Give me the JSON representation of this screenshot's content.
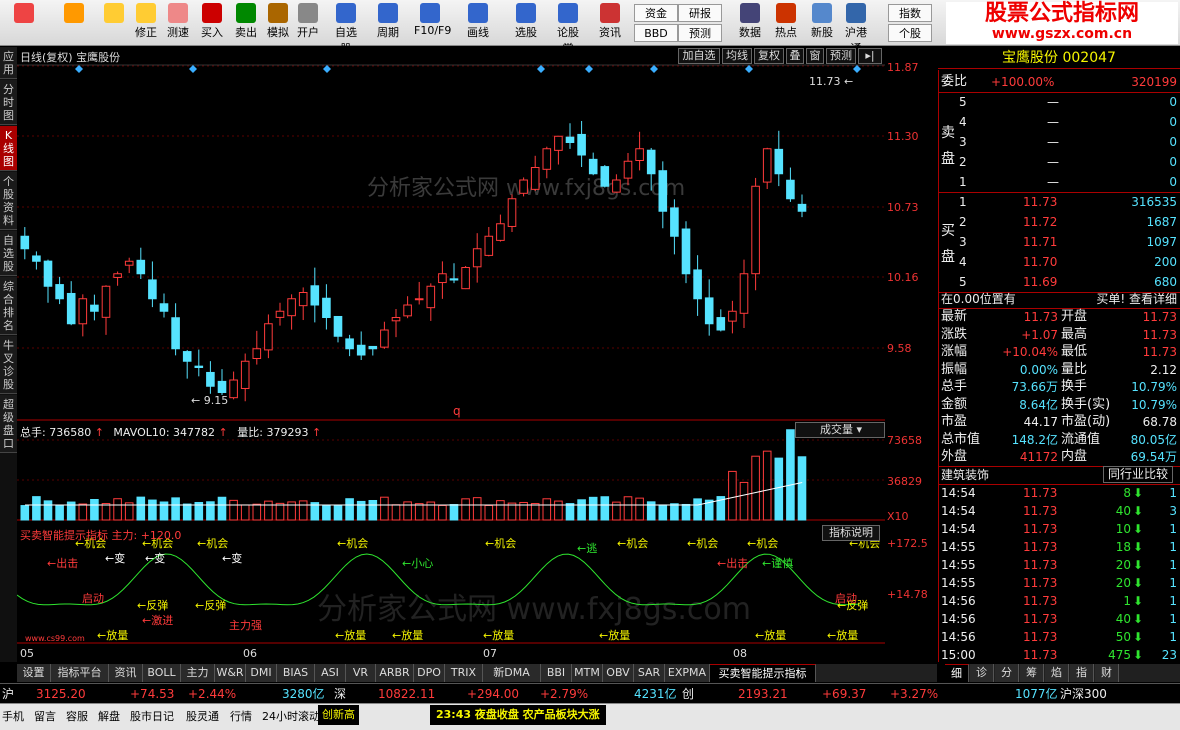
{
  "toolbar": {
    "buttons": [
      {
        "label": "",
        "icon": "window-grid-icon"
      },
      {
        "label": "",
        "icon": "back-arrow-icon"
      },
      {
        "label": "",
        "icon": "up-down-arrows-icon"
      },
      {
        "label": "修正",
        "icon": "refresh-icon"
      },
      {
        "label": "测速",
        "icon": "clock-icon"
      },
      {
        "label": "买入",
        "icon": "buy-icon"
      },
      {
        "label": "卖出",
        "icon": "sell-icon"
      },
      {
        "label": "模拟",
        "icon": "hammer-icon"
      },
      {
        "label": "开户",
        "icon": "lock-icon"
      },
      {
        "label": "自选股",
        "icon": "star-icon"
      },
      {
        "label": "周期",
        "icon": "cycle-icon"
      },
      {
        "label": "F10/F9",
        "icon": "f10-icon"
      },
      {
        "label": "画线",
        "icon": "pen-icon"
      },
      {
        "label": "选股",
        "icon": "select-icon"
      },
      {
        "label": "论股堂",
        "icon": "forum-icon"
      },
      {
        "label": "资讯",
        "icon": "news-icon"
      },
      {
        "label": "数据",
        "icon": "pe-icon"
      },
      {
        "label": "热点",
        "icon": "hot-icon"
      },
      {
        "label": "新股",
        "icon": "ipo-icon"
      },
      {
        "label": "沪港通",
        "icon": "hk-icon"
      }
    ],
    "small_buttons": [
      "资金",
      "BBD",
      "研报",
      "预测",
      "指数",
      "个股"
    ],
    "logo_line1": "股票公式指标网",
    "logo_line2": "www.gszx.com.cn"
  },
  "side_tabs": [
    "应用",
    "分时图",
    "K线图",
    "个股资料",
    "自选股",
    "综合排名",
    "牛叉诊股",
    "超级盘口"
  ],
  "chart": {
    "header": "日线(复权) 宝鹰股份",
    "right_buttons": [
      "加自选",
      "均线",
      "复权",
      "叠",
      "窗",
      "预测"
    ],
    "watermark": "分析家公式网 www.fxj8gs.com",
    "price_labels": [
      "11.87",
      "11.30",
      "10.73",
      "10.16",
      "9.58"
    ],
    "high_mark": "11.73",
    "low_mark": "9.15",
    "q_mark": "q",
    "vol_title": {
      "total": "总手: 736580",
      "mavol": "MAVOL10: 347782",
      "ratio": "量比: 379293"
    },
    "vol_labels": [
      "73658",
      "36829",
      "X10"
    ],
    "vol_selector": "成交量",
    "ind_title": "买卖智能提示指标  主力: +120.0",
    "ind_button": "指标说明",
    "ind_labels": [
      "+172.5",
      "+14.78"
    ],
    "ind_texts": [
      "机会",
      "出击",
      "变",
      "反弹",
      "激进",
      "放量",
      "小心",
      "逃",
      "谨慎",
      "启动",
      "主力",
      "底",
      "主力强",
      "www.cs99.com"
    ],
    "watermark2": "分析家公式网 www.fxj8gs.com",
    "month_labels": [
      "05",
      "06",
      "07",
      "08"
    ]
  },
  "quote": {
    "title": "宝鹰股份  002047",
    "weibi_label": "委比",
    "weibi_value": "+100.00%",
    "weibi_diff": "320199",
    "sell_label": "卖盘",
    "sells": [
      {
        "n": "5",
        "p": "—",
        "v": "0"
      },
      {
        "n": "4",
        "p": "—",
        "v": "0"
      },
      {
        "n": "3",
        "p": "—",
        "v": "0"
      },
      {
        "n": "2",
        "p": "—",
        "v": "0"
      },
      {
        "n": "1",
        "p": "—",
        "v": "0"
      }
    ],
    "buy_label": "买盘",
    "buys": [
      {
        "n": "1",
        "p": "11.73",
        "v": "316535"
      },
      {
        "n": "2",
        "p": "11.72",
        "v": "1687"
      },
      {
        "n": "3",
        "p": "11.71",
        "v": "1097"
      },
      {
        "n": "4",
        "p": "11.70",
        "v": "200"
      },
      {
        "n": "5",
        "p": "11.69",
        "v": "680"
      }
    ],
    "pos_text": "在0.00位置有",
    "pos_right": "买单! 查看详细",
    "stats": [
      [
        "最新",
        "11.73",
        "开盘",
        "11.73"
      ],
      [
        "涨跌",
        "+1.07",
        "最高",
        "11.73"
      ],
      [
        "涨幅",
        "+10.04%",
        "最低",
        "11.73"
      ],
      [
        "振幅",
        "0.00%",
        "量比",
        "2.12"
      ],
      [
        "总手",
        "73.66万",
        "换手",
        "10.79%"
      ],
      [
        "金额",
        "8.64亿",
        "换手(实)",
        "10.79%"
      ],
      [
        "市盈",
        "44.17",
        "市盈(动)",
        "68.78"
      ],
      [
        "总市值",
        "148.2亿",
        "流通值",
        "80.05亿"
      ],
      [
        "外盘",
        "41172",
        "内盘",
        "69.54万"
      ]
    ],
    "sector": "建筑装饰",
    "sector_btn": "同行业比较",
    "ticks": [
      [
        "14:54",
        "11.73",
        "8",
        "1"
      ],
      [
        "14:54",
        "11.73",
        "40",
        "3"
      ],
      [
        "14:54",
        "11.73",
        "10",
        "1"
      ],
      [
        "14:55",
        "11.73",
        "18",
        "1"
      ],
      [
        "14:55",
        "11.73",
        "20",
        "1"
      ],
      [
        "14:55",
        "11.73",
        "20",
        "1"
      ],
      [
        "14:56",
        "11.73",
        "1",
        "1"
      ],
      [
        "14:56",
        "11.73",
        "40",
        "1"
      ],
      [
        "14:56",
        "11.73",
        "50",
        "1"
      ],
      [
        "15:00",
        "11.73",
        "475",
        "23"
      ]
    ],
    "sub_tabs": [
      "细",
      "诊",
      "分",
      "筹",
      "焰",
      "指",
      "财"
    ]
  },
  "bottom_tabs": [
    "设置",
    "指标平台",
    "资讯",
    "BOLL",
    "主力",
    "W&R",
    "DMI",
    "BIAS",
    "ASI",
    "VR",
    "ARBR",
    "DPO",
    "TRIX",
    "新DMA",
    "BBI",
    "MTM",
    "OBV",
    "SAR",
    "EXPMA",
    "买卖智能提示指标"
  ],
  "ticker": {
    "sh_label": "沪",
    "sh_val": "3125.20",
    "sh_chg": "+74.53",
    "sh_pct": "+2.44%",
    "sh_amt": "3280亿",
    "sz_label": "深",
    "sz_val": "10822.11",
    "sz_chg": "+294.00",
    "sz_pct": "+2.79%",
    "sz_amt": "4231亿",
    "cy_label": "创",
    "cy_val": "2193.21",
    "cy_chg": "+69.37",
    "cy_pct": "+3.27%",
    "cy_amt": "1077亿",
    "hs300": "沪深300"
  },
  "status": {
    "items": [
      "手机",
      "留言",
      "容服",
      "解盘",
      "股市日记",
      "股灵通",
      "行情",
      "24小时滚动"
    ],
    "news1": "创新高",
    "news2": "23:43 夜盘收盘 农产品板块大涨"
  },
  "colors": {
    "up": "#ff3b3b",
    "down": "#56e3ff",
    "frame": "#aa0000",
    "accent": "#ffff00"
  }
}
